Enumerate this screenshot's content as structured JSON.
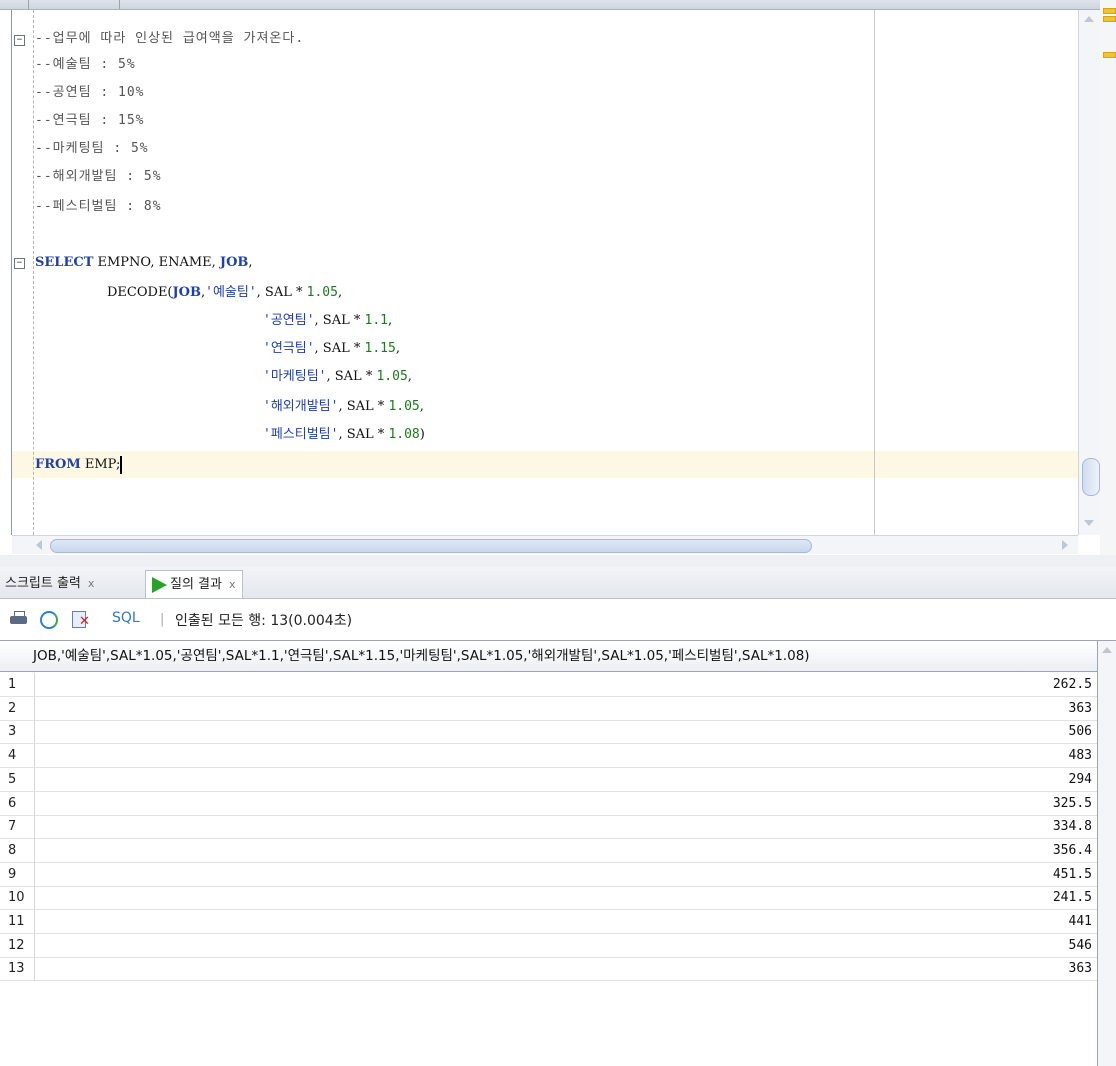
{
  "editor": {
    "comments": [
      "--업무에 따라 인상된 급여액을 가져온다.",
      "--예술팀 : 5%",
      "--공연팀 : 10%",
      "--연극팀 : 15%",
      "--마케팅팀 : 5%",
      "--해외개발팀 : 5%",
      "--페스티벌팀 : 8%"
    ],
    "sql": {
      "l1_kw": "SELECT",
      "l1_cols": " EMPNO, ENAME, ",
      "l1_job": "JOB",
      "l1_end": ",",
      "l2_fn": "DECODE(",
      "l2_job": "JOB",
      "l2_comma": ",",
      "l2_str": "'예술팀'",
      "l2_expr": ", SAL * ",
      "l2_num": "1.05",
      "l2_end": ",",
      "cases": [
        {
          "str": "'공연팀'",
          "expr": ", SAL * ",
          "num": "1.1",
          "end": ","
        },
        {
          "str": "'연극팀'",
          "expr": ", SAL * ",
          "num": "1.15",
          "end": ","
        },
        {
          "str": "'마케팅팀'",
          "expr": ", SAL * ",
          "num": "1.05",
          "end": ","
        },
        {
          "str": "'해외개발팀'",
          "expr": ", SAL * ",
          "num": "1.05",
          "end": ","
        },
        {
          "str": "'페스티벌팀'",
          "expr": ", SAL * ",
          "num": "1.08",
          "end": ")"
        }
      ],
      "from_kw": "FROM",
      "from_rest": " EMP;"
    },
    "fold_minus": "−"
  },
  "result_panel": {
    "tabs": [
      {
        "label": "스크립트 출력",
        "close": "x"
      },
      {
        "label": "질의 결과",
        "close": "x"
      }
    ],
    "toolbar": {
      "sql_link": "SQL",
      "separator": "|",
      "status": "인출된 모든 행: 13(0.004초)"
    },
    "grid": {
      "column_header": "JOB,'예술팀',SAL*1.05,'공연팀',SAL*1.1,'연극팀',SAL*1.15,'마케팅팀',SAL*1.05,'해외개발팀',SAL*1.05,'페스티벌팀',SAL*1.08)",
      "rows": [
        {
          "n": "1",
          "v": "262.5"
        },
        {
          "n": "2",
          "v": "363"
        },
        {
          "n": "3",
          "v": "506"
        },
        {
          "n": "4",
          "v": "483"
        },
        {
          "n": "5",
          "v": "294"
        },
        {
          "n": "6",
          "v": "325.5"
        },
        {
          "n": "7",
          "v": "334.8"
        },
        {
          "n": "8",
          "v": "356.4"
        },
        {
          "n": "9",
          "v": "451.5"
        },
        {
          "n": "10",
          "v": "241.5"
        },
        {
          "n": "11",
          "v": "441"
        },
        {
          "n": "12",
          "v": "546"
        },
        {
          "n": "13",
          "v": "363"
        }
      ]
    }
  },
  "colors": {
    "keyword": "#1f3fae",
    "number": "#1b7a1b",
    "current_line": "#fdf8e4",
    "run_icon": "#2aa12a"
  }
}
